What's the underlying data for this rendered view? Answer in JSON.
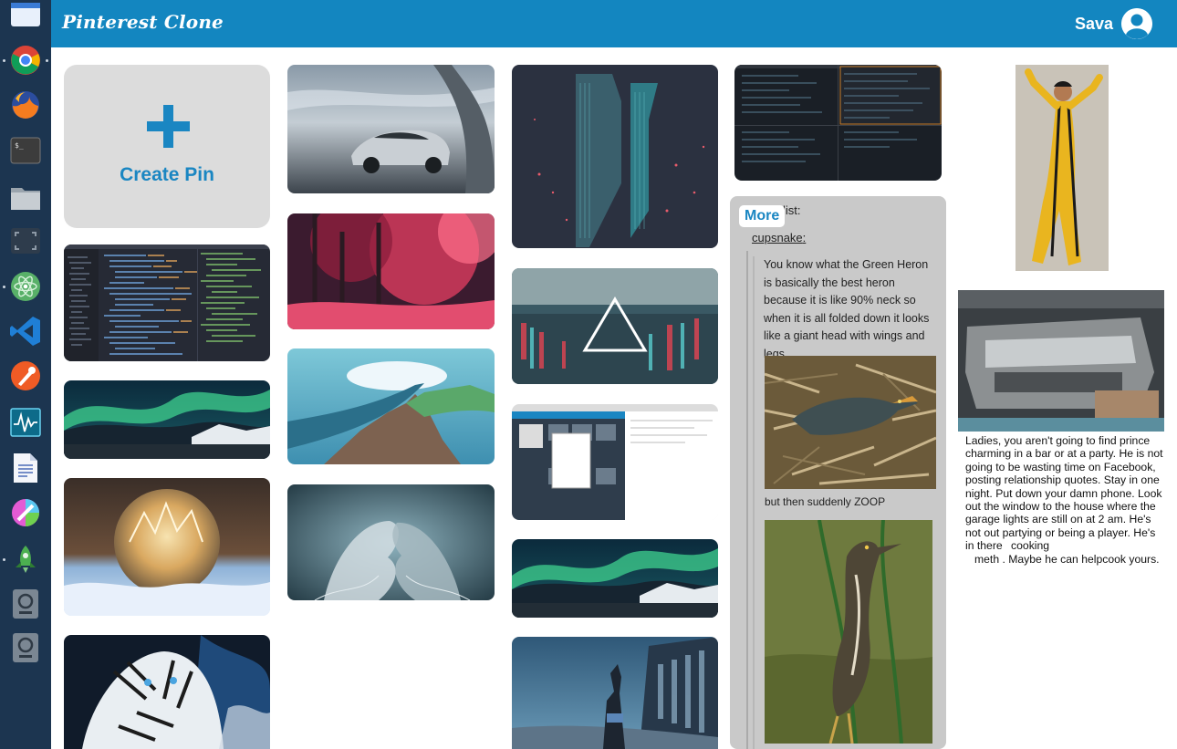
{
  "header": {
    "brand": "Pinterest Clone",
    "user_name": "Sava"
  },
  "dock": {
    "icons": [
      "window-icon",
      "chrome-icon",
      "firefox-icon",
      "terminal-icon",
      "folder-icon",
      "screenshot-icon",
      "atom-icon",
      "vscode-icon",
      "postman-icon",
      "system-monitor-icon",
      "text-editor-icon",
      "color-picker-icon",
      "rocket-icon",
      "disk-icon",
      "disk-icon"
    ]
  },
  "create_pin": {
    "label": "Create Pin"
  },
  "text_pin": {
    "more_label": "More",
    "list_label": "list:",
    "username": "cupsnake",
    "username_suffix": ":",
    "quote": "You know what the Green Heron is basically the best heron because it is like 90% neck so when it is all folded down it looks like a giant head with wings and legs",
    "zoop": "but then suddenly ZOOP"
  },
  "caption_pin": {
    "text_1": "Ladies, you aren't going to find prince charming in a bar or at a party. He is not going to be wasting time on Facebook, posting relationship quotes.  Stay in one night. Put down your damn phone. Look out the window to the house where the garage lights are still on at 2 am. He's not out partying or being a player. He's in there",
    "text_2": "cooking",
    "text_3": "meth . Maybe he can help",
    "text_4": "cook yours."
  },
  "colors": {
    "header": "#1386c0",
    "dock": "#1c3550",
    "accent_text": "#1a86c2",
    "create_bg": "#dcdcdc"
  }
}
